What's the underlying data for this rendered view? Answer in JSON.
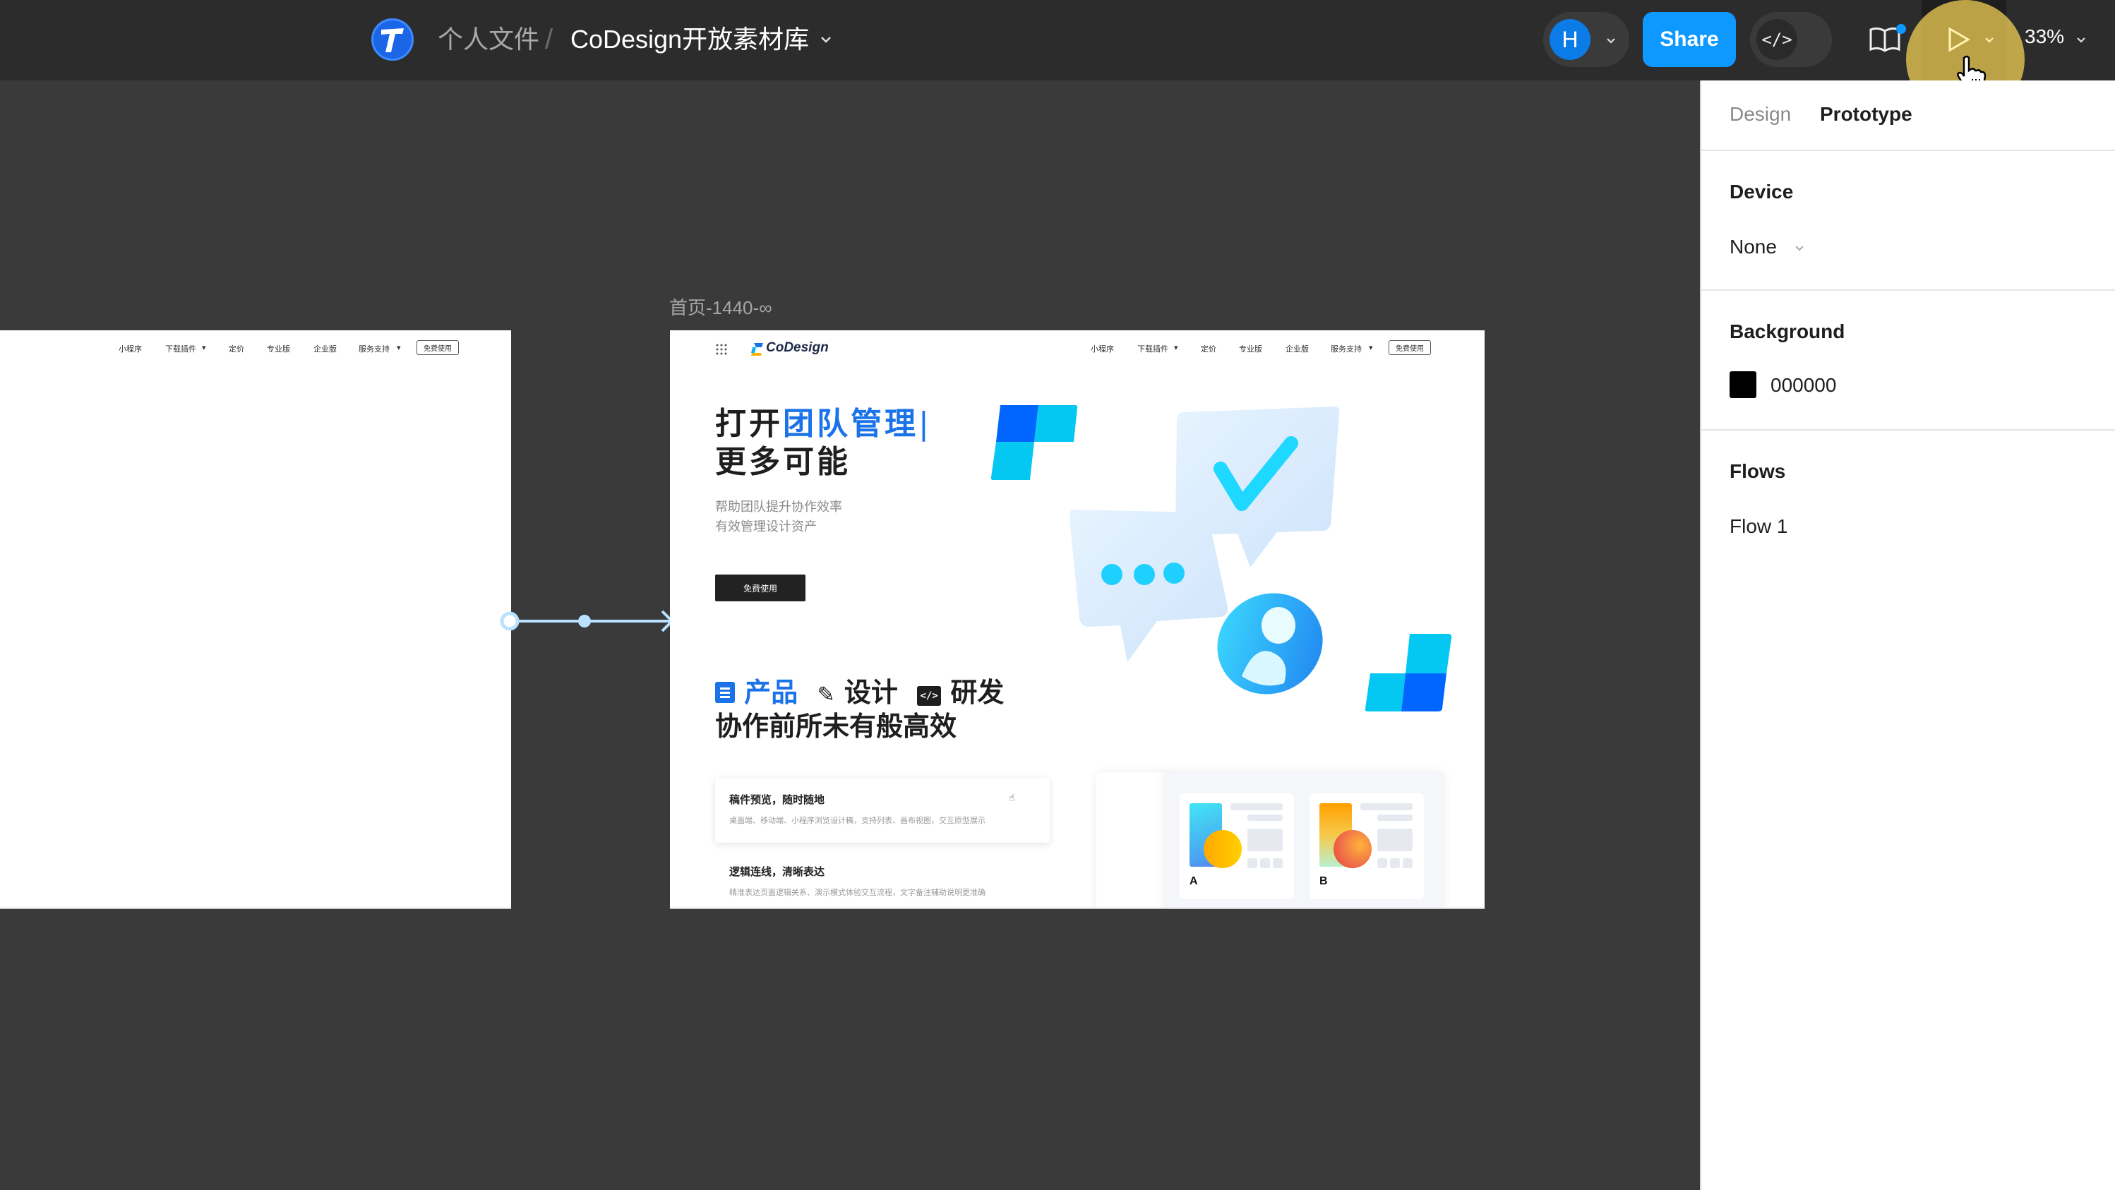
{
  "topbar": {
    "breadcrumb_parent": "个人文件",
    "breadcrumb_separator": "/",
    "file_name": "CoDesign开放素材库",
    "avatar_initial": "H",
    "share_label": "Share",
    "code_icon_text": "</>",
    "zoom_level": "33%"
  },
  "panel": {
    "tabs": [
      {
        "label": "Design",
        "active": false
      },
      {
        "label": "Prototype",
        "active": true
      }
    ],
    "device": {
      "title": "Device",
      "value": "None"
    },
    "background": {
      "title": "Background",
      "value": "000000",
      "color": "#000000"
    },
    "flows": {
      "title": "Flows",
      "items": [
        "Flow 1"
      ]
    }
  },
  "canvas": {
    "frame_label": "首页-1440-∞",
    "nav": {
      "items": [
        "小程序",
        "下载插件",
        "定价",
        "专业版",
        "企业版",
        "服务支持"
      ],
      "dropdown_flags": [
        false,
        true,
        false,
        false,
        false,
        true
      ],
      "cta": "免费使用",
      "brand": "CoDesign"
    },
    "hero": {
      "title_prefix": "打开",
      "title_highlight": "团队管理",
      "title_line2": "更多可能",
      "sub_line1": "帮助团队提升协作效率",
      "sub_line2": "有效管理设计资产",
      "cta": "免费使用"
    },
    "section": {
      "tags": [
        "产品",
        "设计",
        "研发"
      ],
      "headline": "协作前所未有般高效"
    },
    "features": [
      {
        "title": "稿件预览，随时随地",
        "desc": "桌面端、移动端、小程序浏览设计稿，支持列表、画布视图，交互原型展示"
      },
      {
        "title": "逻辑连线，清晰表达",
        "desc": "精准表达页面逻辑关系、演示模式体验交互流程，文字备注辅助说明更准确"
      }
    ],
    "mock_cards": [
      "A",
      "B"
    ]
  },
  "colors": {
    "accent": "#0d99ff",
    "brand_blue": "#1a73e8",
    "highlight": "#fad658"
  }
}
